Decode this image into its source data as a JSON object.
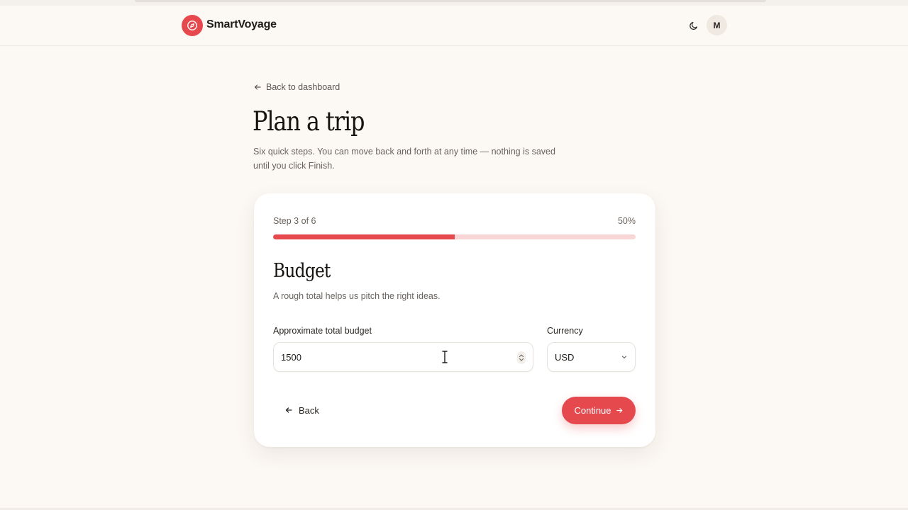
{
  "app": {
    "brand_name": "SmartVoyage",
    "logo_icon": "compass-icon",
    "theme_icon": "moon-icon",
    "avatar_initial": "M"
  },
  "colors": {
    "accent": "#e5484d",
    "accent_soft": "#f8d6d6",
    "background": "#fcf8f3",
    "card": "#ffffff"
  },
  "page": {
    "back_link": "Back to dashboard",
    "title": "Plan a trip",
    "subtitle": "Six quick steps. You can move back and forth at any time — nothing is saved until you click Finish."
  },
  "wizard": {
    "step_label": "Step 3 of 6",
    "progress_label": "50%",
    "progress_value": 0.5,
    "section_title": "Budget",
    "section_description": "A rough total helps us pitch the right ideas.",
    "budget_label": "Approximate total budget",
    "budget_value": "1500",
    "currency_label": "Currency",
    "currency_value": "USD",
    "back_button": "Back",
    "continue_button": "Continue"
  }
}
